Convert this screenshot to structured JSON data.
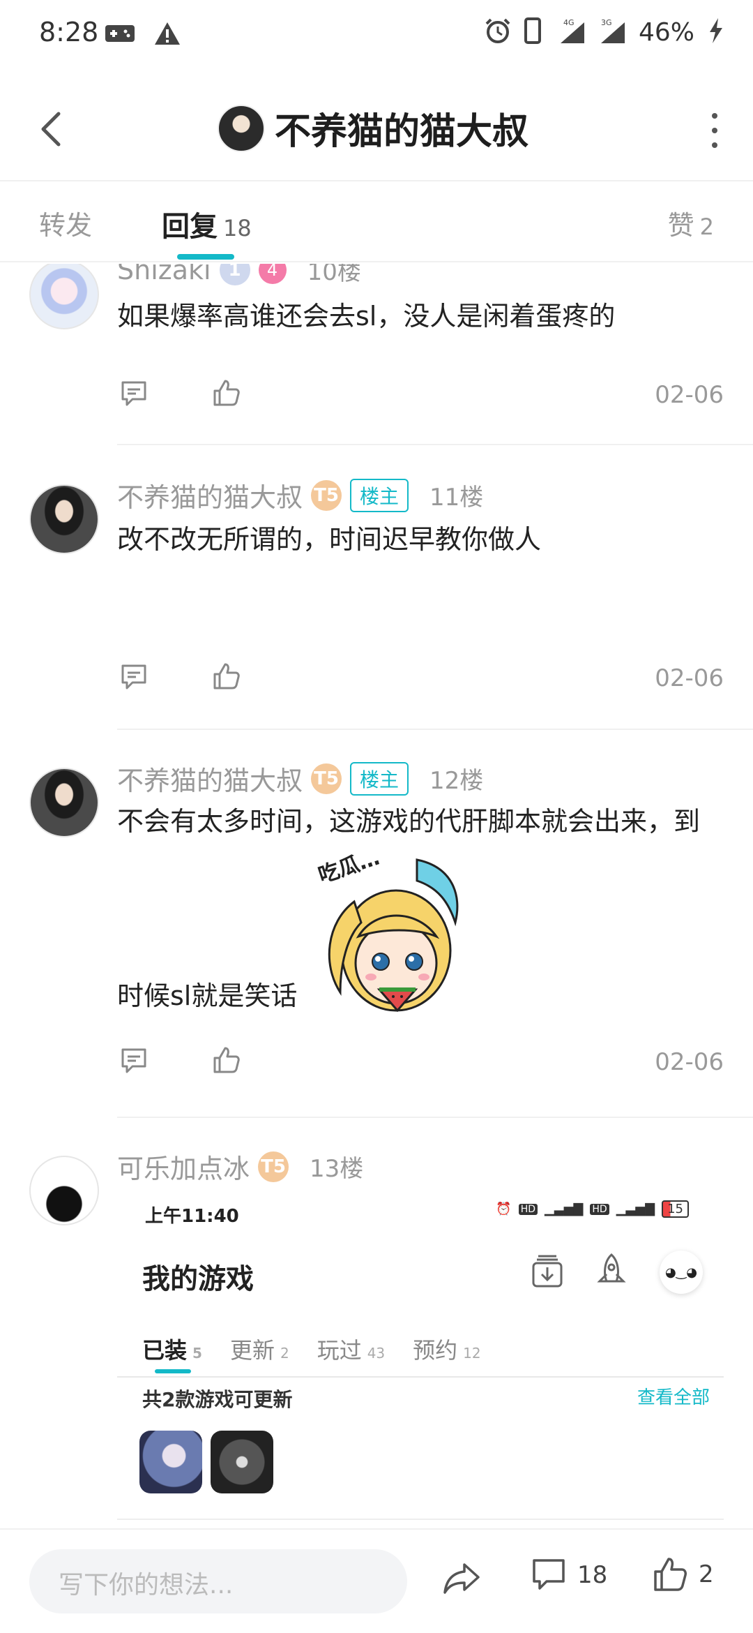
{
  "status_bar": {
    "time": "8:28",
    "battery": "46%",
    "net1": "4G",
    "net2": "3G"
  },
  "header": {
    "title": "不养猫的猫大叔"
  },
  "tabs": {
    "forward": "转发",
    "reply": "回复",
    "reply_count": "18",
    "like": "赞",
    "like_count": "2"
  },
  "replies": [
    {
      "name": "Shizaki",
      "badge1": "1",
      "badge2": "4",
      "floor": "10楼",
      "text": "如果爆率高谁还会去sl，没人是闲着蛋疼的",
      "date": "02-06"
    },
    {
      "name": "不养猫的猫大叔",
      "badge": "T5",
      "tag": "楼主",
      "floor": "11楼",
      "text": "改不改无所谓的，时间迟早教你做人",
      "date": "02-06"
    },
    {
      "name": "不养猫的猫大叔",
      "badge": "T5",
      "tag": "楼主",
      "floor": "12楼",
      "text_line1": "不会有太多时间，这游戏的代肝脚本就会出来，到",
      "text_line2": "时候sl就是笑话",
      "sticker_caption": "吃瓜…",
      "date": "02-06"
    },
    {
      "name": "可乐加点冰",
      "badge": "T5",
      "floor": "13楼"
    }
  ],
  "embedded_screenshot": {
    "time": "上午11:40",
    "battery": "15",
    "title": "我的游戏",
    "tabs": [
      {
        "label": "已装",
        "count": "5"
      },
      {
        "label": "更新",
        "count": "2"
      },
      {
        "label": "玩过",
        "count": "43"
      },
      {
        "label": "预约",
        "count": "12"
      }
    ],
    "update_text": "共2款游戏可更新",
    "view_all": "查看全部"
  },
  "bottom_bar": {
    "placeholder": "写下你的想法...",
    "comment_count": "18",
    "like_count": "2"
  }
}
